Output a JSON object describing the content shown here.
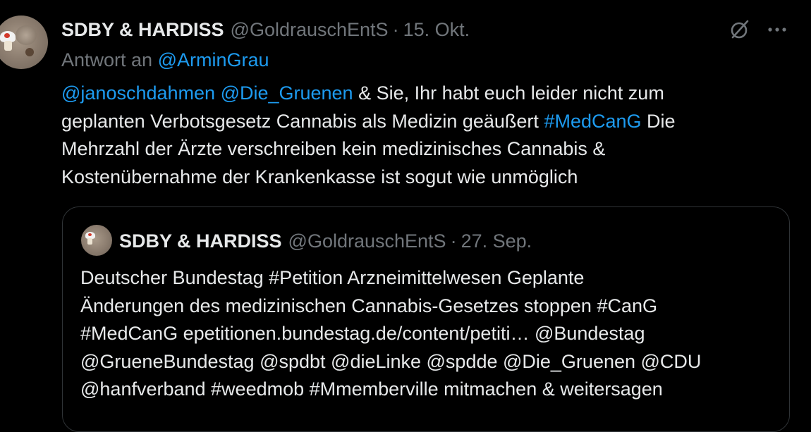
{
  "tweet": {
    "display_name": "SDBY & HARDISS",
    "handle": "@GoldrauschEntS",
    "separator": "·",
    "date": "15. Okt.",
    "reply_prefix": "Antwort an",
    "reply_to": "@ArminGrau",
    "body": {
      "line1": {
        "mention1": "@janoschdahmen",
        "mention2": "@Die_Gruenen",
        "text": " & Sie, Ihr habt euch leider nicht zum"
      },
      "line2": {
        "text": "geplanten Verbotsgesetz Cannabis als Medizin geäußert ",
        "hashtag": "#MedCanG",
        "text_after": " Die"
      },
      "line3": "Mehrzahl der Ärzte verschreiben kein medizinisches Cannabis  &",
      "line4": "Kostenübernahme der Krankenkasse ist sogut wie unmöglich"
    },
    "icons": {
      "grok": "grok-icon",
      "more": "more-options-icon"
    }
  },
  "quoted": {
    "display_name": "SDBY & HARDISS",
    "handle": "@GoldrauschEntS",
    "separator": "·",
    "date": "27. Sep.",
    "lines": [
      "Deutscher Bundestag #Petition Arzneimittelwesen Geplante",
      "Änderungen des medizinischen Cannabis-Gesetzes stoppen #CanG",
      "#MedCanG epetitionen.bundestag.de/content/petiti… @Bundestag",
      "@GrueneBundestag @spdbt @dieLinke @spdde @Die_Gruenen @CDU",
      "@hanfverband #weedmob #Mmemberville mitmachen & weitersagen"
    ]
  },
  "colors": {
    "background": "#000000",
    "text": "#e7e9ea",
    "secondary": "#71767b",
    "link": "#1d9bf0",
    "border": "#2f3336"
  }
}
